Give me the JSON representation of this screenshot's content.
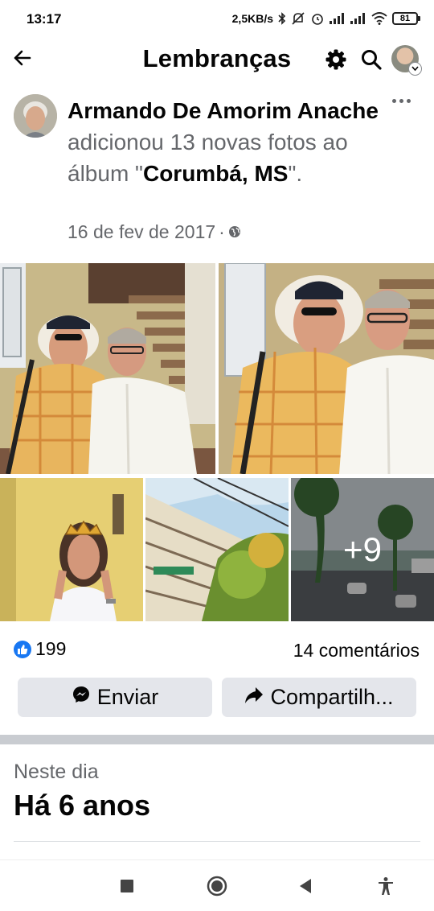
{
  "status_bar": {
    "time": "13:17",
    "network_speed": "2,5KB/s",
    "battery": "81"
  },
  "header": {
    "title": "Lembranças",
    "icons": [
      "back-arrow-icon",
      "gear-icon",
      "search-icon",
      "profile-avatar"
    ]
  },
  "post": {
    "author": "Armando De Amorim Anache",
    "action": " adicionou 13 novas fotos ao álbum \"",
    "album": "Corumbá, MS",
    "action_end": "\".",
    "date": "16 de fev de 2017",
    "separator": "·",
    "audience_icon": "globe-icon",
    "photos_more": "+9",
    "likes": "199",
    "comments": "14 comentários",
    "send_label": "Enviar",
    "share_label": "Compartilh..."
  },
  "on_this_day": {
    "label": "Neste dia",
    "title": "Há 6 anos"
  },
  "colors": {
    "accent": "#1877f2",
    "button_bg": "#e4e6eb",
    "secondary_text": "#65676b"
  }
}
